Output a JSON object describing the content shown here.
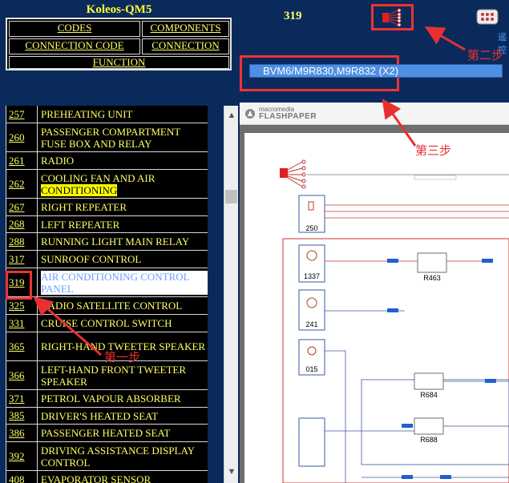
{
  "app": {
    "title": "Koleos-QM5"
  },
  "nav": {
    "codes": "CODES",
    "components": "COMPONENTS",
    "connection_code": "CONNECTION CODE",
    "connection": "CONNECTION",
    "function": "FUNCTION"
  },
  "list": [
    {
      "code": "257",
      "label": "PREHEATING UNIT"
    },
    {
      "code": "260",
      "label": "PASSENGER COMPARTMENT FUSE BOX AND RELAY"
    },
    {
      "code": "261",
      "label": "RADIO"
    },
    {
      "code": "262",
      "label": "COOLING FAN AND AIR",
      "label2": "CONDITIONING"
    },
    {
      "code": "267",
      "label": "RIGHT REPEATER"
    },
    {
      "code": "268",
      "label": "LEFT REPEATER"
    },
    {
      "code": "288",
      "label": "RUNNING LIGHT MAIN RELAY"
    },
    {
      "code": "317",
      "label": "SUNROOF CONTROL"
    },
    {
      "code": "319",
      "label": "AIR CONDITIONING CONTROL PANEL"
    },
    {
      "code": "325",
      "label": "RADIO SATELLITE CONTROL"
    },
    {
      "code": "331",
      "label": "CRUISE CONTROL SWITCH"
    },
    {
      "code": "365",
      "label": "RIGHT-HAND TWEETER SPEAKER"
    },
    {
      "code": "366",
      "label": "LEFT-HAND FRONT TWEETER SPEAKER"
    },
    {
      "code": "371",
      "label": "PETROL VAPOUR ABSORBER"
    },
    {
      "code": "385",
      "label": "DRIVER'S HEATED SEAT"
    },
    {
      "code": "386",
      "label": "PASSENGER HEATED SEAT"
    },
    {
      "code": "392",
      "label": "DRIVING ASSISTANCE DISPLAY CONTROL"
    },
    {
      "code": "408",
      "label": "EVAPORATOR SENSOR"
    }
  ],
  "viewer_header": {
    "page_number": "319",
    "selected_connector": "BVM6/M9R830,M9R832 (X2)"
  },
  "viewer": {
    "brand_top": "macromedia",
    "brand": "FLASHPAPER"
  },
  "diagram": {
    "components": [
      "250",
      "1337",
      "241",
      "015"
    ],
    "relays": [
      "R463",
      "R684",
      "R688"
    ],
    "side_text": "遥控"
  },
  "annotations": {
    "step1": "第一步",
    "step2": "第二步",
    "step3": "第三步"
  },
  "colors": {
    "accent_red": "#e33333",
    "nav_yellow": "#ffff66",
    "background_navy": "#0b2a5c",
    "select_blue": "#4f8fe0"
  }
}
